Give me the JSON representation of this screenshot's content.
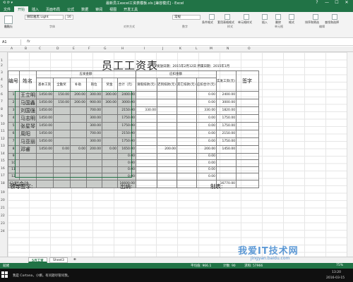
{
  "window": {
    "title": "最新员工excel工资表模板.xls [兼容模式] - Excel",
    "quick_access": "⟲ ⟳ ▾",
    "controls": [
      "?",
      "—",
      "☐",
      "✕"
    ]
  },
  "ribbon_tabs": [
    "文件",
    "开始",
    "插入",
    "页面布局",
    "公式",
    "数据",
    "审阅",
    "视图",
    "开发工具"
  ],
  "ribbon": {
    "font_name": "微软雅黑 Light",
    "font_size": "16",
    "number_format": "常规",
    "groups": [
      "剪贴板",
      "字体",
      "对齐方式",
      "数字",
      "样式",
      "单元格",
      "编辑"
    ],
    "buttons": [
      "粘贴",
      "条件格式",
      "套用表格格式",
      "单元格样式",
      "插入",
      "删除",
      "格式",
      "排序和筛选",
      "查找和选择"
    ]
  },
  "formula_bar": {
    "name_box": "A1",
    "fx": "fx"
  },
  "columns": [
    "A",
    "B",
    "C",
    "D",
    "E",
    "F",
    "G",
    "H",
    "I",
    "J",
    "K",
    "L",
    "M",
    "N",
    "O"
  ],
  "rows": [
    "1",
    "2",
    "3",
    "4",
    "5",
    "6",
    "7",
    "8",
    "9",
    "10",
    "11",
    "12",
    "13",
    "14",
    "15",
    "16",
    "17",
    "18",
    "19",
    "20",
    "21",
    "22",
    "23",
    "24"
  ],
  "sheet": {
    "title": "员工工资表",
    "meta": "发放日期：2015年2月12日  所属日期：2015年1月",
    "headers": {
      "num": "编号",
      "name": "姓名",
      "payable": "应发金额",
      "deduct": "应扣金额",
      "actual": "实发工资(元)",
      "sign": "签字"
    },
    "subheaders": [
      "基本工资",
      "全勤奖",
      "补助",
      "岗位",
      "奖金",
      "合计（元）",
      "请假扣款(元)",
      "迟到扣款(元)",
      "其它扣款(元)",
      "应扣合计(元)"
    ],
    "rows": [
      {
        "no": "1",
        "name": "王立明",
        "v": [
          "1450.00",
          "150.00",
          "200.00",
          "300.00",
          "300.00",
          "2400.00",
          "",
          "",
          "",
          "0.00",
          "2400.00"
        ]
      },
      {
        "no": "2",
        "name": "马国鑫",
        "v": [
          "1450.00",
          "150.00",
          "200.00",
          "900.00",
          "300.00",
          "3000.00",
          "",
          "",
          "",
          "0.00",
          "3000.00"
        ]
      },
      {
        "no": "3",
        "name": "刘国强",
        "v": [
          "1450.00",
          "",
          "",
          "700.00",
          "",
          "2150.00",
          "330.00",
          "",
          "",
          "330.00",
          "1820.00"
        ]
      },
      {
        "no": "4",
        "name": "马志明",
        "v": [
          "1450.00",
          "",
          "",
          "300.00",
          "",
          "1750.00",
          "",
          "",
          "",
          "0.00",
          "1750.00"
        ]
      },
      {
        "no": "5",
        "name": "张星琴",
        "v": [
          "1450.00",
          "",
          "",
          "300.00",
          "",
          "1750.00",
          "",
          "",
          "",
          "0.00",
          "1750.00"
        ]
      },
      {
        "no": "6",
        "name": "周阳",
        "v": [
          "1450.00",
          "",
          "",
          "700.00",
          "",
          "2150.00",
          "",
          "",
          "",
          "0.00",
          "2150.00"
        ]
      },
      {
        "no": "7",
        "name": "马亚丽",
        "v": [
          "1450.00",
          "",
          "",
          "300.00",
          "",
          "1750.00",
          "",
          "",
          "",
          "0.00",
          "1750.00"
        ]
      },
      {
        "no": "8",
        "name": "邓睿",
        "v": [
          "1450.00",
          "0.00",
          "0.00",
          "200.00",
          "0.00",
          "1650.00",
          "",
          "200.00",
          "",
          "200.00",
          "1450.00"
        ]
      },
      {
        "no": "9",
        "name": "",
        "v": [
          "",
          "",
          "",
          "",
          "",
          "0.00",
          "",
          "",
          "",
          "0.00",
          ""
        ]
      },
      {
        "no": "10",
        "name": "",
        "v": [
          "",
          "",
          "",
          "",
          "",
          "0.00",
          "",
          "",
          "",
          "0.00",
          ""
        ]
      },
      {
        "no": "11",
        "name": "",
        "v": [
          "",
          "",
          "",
          "",
          "",
          "0.00",
          "",
          "",
          "",
          "0.00",
          ""
        ]
      },
      {
        "no": "12",
        "name": "",
        "v": [
          "",
          "",
          "",
          "",
          "",
          "0.00",
          "",
          "",
          "",
          "0.00",
          ""
        ]
      }
    ],
    "subtotal": {
      "label": "分栏合计",
      "payable": "16600.00",
      "actual": "16770.00"
    },
    "signatures": [
      "领导签字:",
      "出纳:",
      "制表:"
    ]
  },
  "sheet_tabs": [
    "5月工资",
    "Sheet3",
    "⊕"
  ],
  "status": {
    "ready": "就绪",
    "average": "平均值: 966.1",
    "count": "计数: 90",
    "sum": "求和: 57966",
    "zoom": "75%"
  },
  "taskbar": {
    "search": "我是 Cortana，小娜。有问题尽管问我。",
    "time": "13:20",
    "date": "2016-03-15"
  },
  "watermark": {
    "main": "我爱IT技术网",
    "url": "jingyan.baidu.com"
  }
}
